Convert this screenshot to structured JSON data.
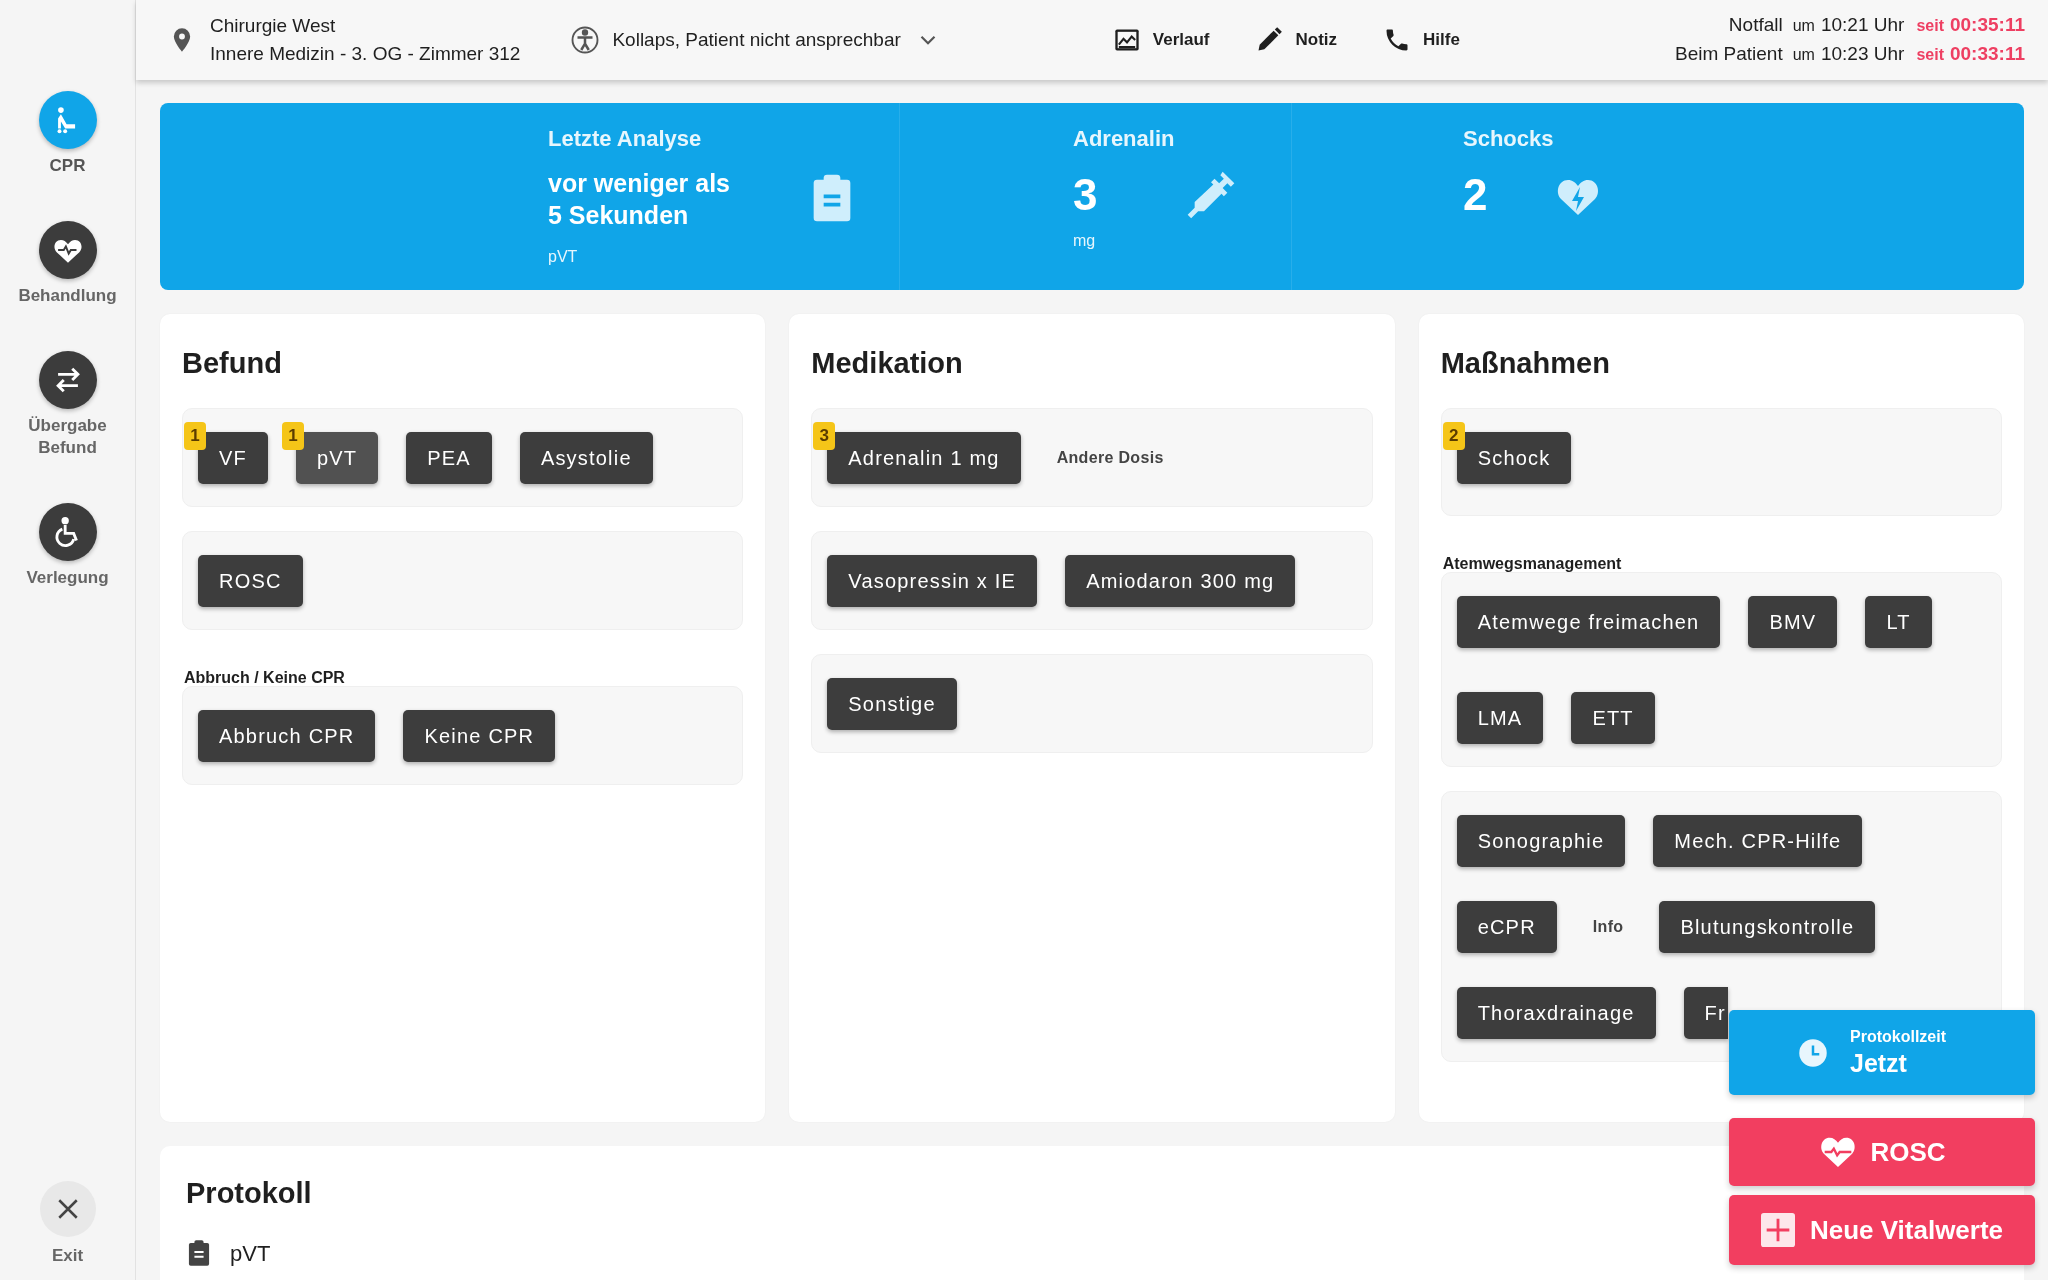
{
  "sidebar": {
    "items": [
      {
        "label": "CPR",
        "selected": true
      },
      {
        "label": "Behandlung",
        "selected": false
      },
      {
        "label": "Übergabe Befund",
        "selected": false
      },
      {
        "label": "Verlegung",
        "selected": false
      }
    ],
    "exit": {
      "label": "Exit"
    }
  },
  "top_bar": {
    "location": {
      "line1": "Chirurgie West",
      "line2": "Innere Medizin - 3. OG - Zimmer 312"
    },
    "reason": {
      "text": "Kollaps, Patient nicht ansprechbar"
    },
    "actions": [
      {
        "label": "Verlauf"
      },
      {
        "label": "Notiz"
      },
      {
        "label": "Hilfe"
      }
    ],
    "times": [
      {
        "label": "Notfall",
        "um": "um",
        "time": "10:21 Uhr",
        "seit": "seit",
        "elapsed": "00:35:11"
      },
      {
        "label": "Beim Patient",
        "um": "um",
        "time": "10:23 Uhr",
        "seit": "seit",
        "elapsed": "00:33:11"
      }
    ]
  },
  "banner": [
    {
      "title": "Letzte Analyse",
      "value": "vor weniger als 5 Sekunden",
      "sub": "pVT"
    },
    {
      "title": "Adrenalin",
      "value": "3",
      "sub": "mg"
    },
    {
      "title": "Schocks",
      "value": "2"
    }
  ],
  "sections": [
    {
      "title": "Befund",
      "groups": [
        {
          "lines": [
            [
              {
                "kind": "button",
                "label": "VF",
                "count": "1",
                "selected": false
              },
              {
                "kind": "button",
                "label": "pVT",
                "count": "1",
                "selected": true
              },
              {
                "kind": "button",
                "label": "PEA",
                "selected": false
              },
              {
                "kind": "button",
                "label": "Asystolie",
                "selected": false
              }
            ]
          ]
        },
        {
          "lines": [
            [
              {
                "kind": "button",
                "label": "ROSC"
              }
            ]
          ]
        },
        {
          "label": "Abbruch / Keine CPR",
          "lines": [
            [
              {
                "kind": "button",
                "label": "Abbruch CPR"
              },
              {
                "kind": "button",
                "label": "Keine CPR"
              }
            ]
          ]
        }
      ]
    },
    {
      "title": "Medikation",
      "groups": [
        {
          "lines": [
            [
              {
                "kind": "button",
                "label": "Adrenalin 1 mg",
                "count": "3"
              },
              {
                "kind": "link",
                "label": "Andere Dosis"
              }
            ]
          ]
        },
        {
          "lines": [
            [
              {
                "kind": "button",
                "label": "Vasopressin x IE"
              },
              {
                "kind": "button",
                "label": "Amiodaron 300 mg"
              }
            ]
          ]
        },
        {
          "lines": [
            [
              {
                "kind": "button",
                "label": "Sonstige"
              }
            ]
          ]
        }
      ]
    },
    {
      "title": "Maßnahmen",
      "groups": [
        {
          "lines": [
            [
              {
                "kind": "button",
                "label": "Schock",
                "count": "2"
              }
            ]
          ]
        },
        {
          "label": "Atemwegsmanagement",
          "lines": [
            [
              {
                "kind": "button",
                "label": "Atemwege freimachen"
              },
              {
                "kind": "button",
                "label": "BMV"
              },
              {
                "kind": "button",
                "label": "LT"
              }
            ],
            [
              {
                "kind": "button",
                "label": "LMA"
              },
              {
                "kind": "button",
                "label": "ETT"
              }
            ]
          ]
        },
        {
          "lines": [
            [
              {
                "kind": "button",
                "label": "Sonographie"
              },
              {
                "kind": "button",
                "label": "Mech. CPR-Hilfe"
              }
            ],
            [
              {
                "kind": "button",
                "label": "eCPR"
              },
              {
                "kind": "link",
                "label": "Info"
              },
              {
                "kind": "button",
                "label": "Blutungskontrolle"
              }
            ],
            [
              {
                "kind": "button",
                "label": "Thoraxdrainage"
              },
              {
                "kind": "button",
                "label": "Fr"
              }
            ]
          ]
        }
      ]
    }
  ],
  "protocol": {
    "title": "Protokoll",
    "entries": [
      {
        "text": "pVT"
      }
    ]
  },
  "floating": {
    "protocol_time": {
      "label": "Protokollzeit",
      "value": "Jetzt"
    },
    "rosc": {
      "label": "ROSC"
    },
    "vitals": {
      "label": "Neue Vitalwerte"
    }
  }
}
